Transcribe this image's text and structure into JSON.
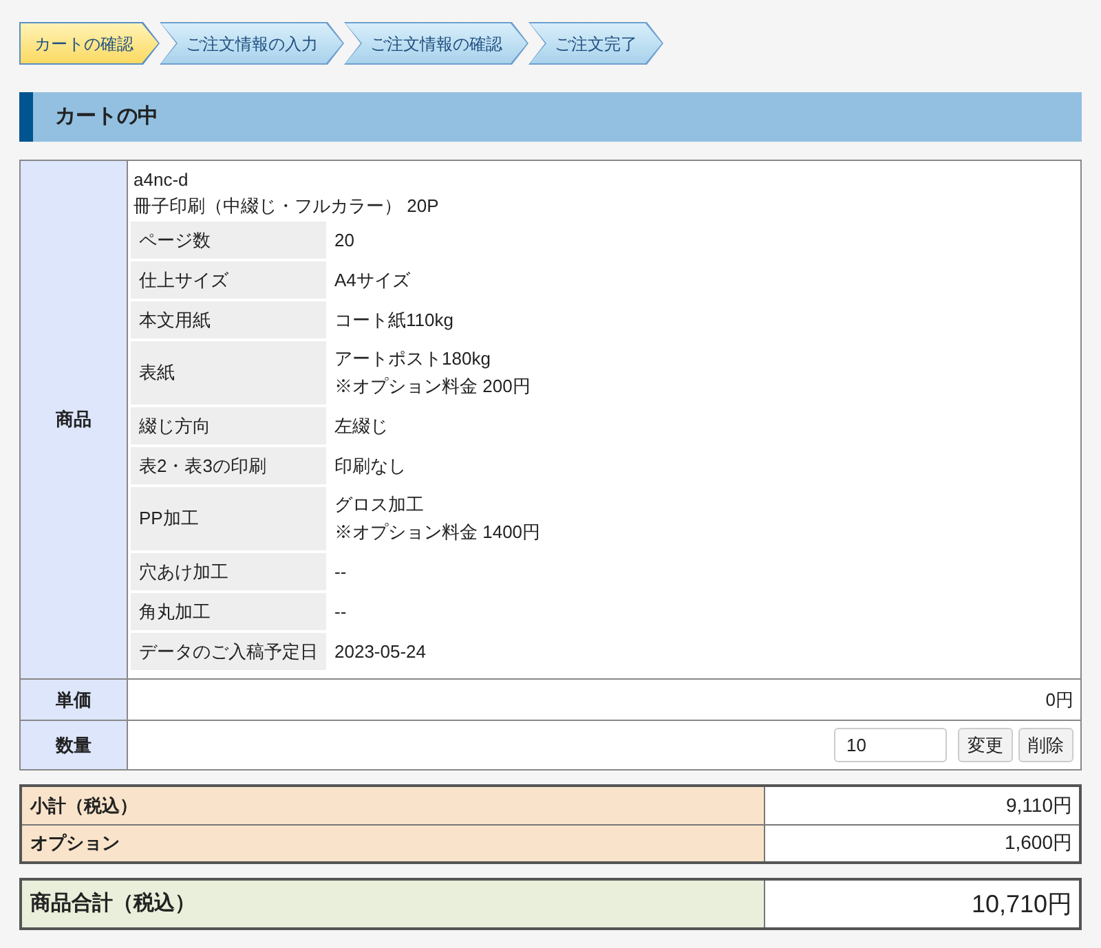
{
  "steps": [
    {
      "label": "カートの確認",
      "selected": true
    },
    {
      "label": "ご注文情報の入力",
      "selected": false
    },
    {
      "label": "ご注文情報の確認",
      "selected": false
    },
    {
      "label": "ご注文完了",
      "selected": false
    }
  ],
  "section_title": "カートの中",
  "cart": {
    "product_label": "商品",
    "product_code": "a4nc-d",
    "product_name": "冊子印刷（中綴じ・フルカラー） 20P",
    "specs": [
      {
        "label": "ページ数",
        "value": [
          "20"
        ]
      },
      {
        "label": "仕上サイズ",
        "value": [
          "A4サイズ"
        ]
      },
      {
        "label": "本文用紙",
        "value": [
          "コート紙110kg"
        ]
      },
      {
        "label": "表紙",
        "value": [
          "アートポスト180kg",
          "※オプション料金 200円"
        ]
      },
      {
        "label": "綴じ方向",
        "value": [
          "左綴じ"
        ]
      },
      {
        "label": "表2・表3の印刷",
        "value": [
          "印刷なし"
        ]
      },
      {
        "label": "PP加工",
        "value": [
          "グロス加工",
          "※オプション料金 1400円"
        ]
      },
      {
        "label": "穴あけ加工",
        "value": [
          "--"
        ]
      },
      {
        "label": "角丸加工",
        "value": [
          "--"
        ]
      },
      {
        "label": "データのご入稿予定日",
        "value": [
          "2023-05-24"
        ]
      }
    ],
    "unit_price_label": "単価",
    "unit_price": "0円",
    "quantity_label": "数量",
    "quantity": "10",
    "change_button": "変更",
    "delete_button": "削除"
  },
  "subtotals": [
    {
      "label": "小計（税込）",
      "value": "9,110円"
    },
    {
      "label": "オプション",
      "value": "1,600円"
    }
  ],
  "total": {
    "label": "商品合計（税込）",
    "value": "10,710円"
  }
}
